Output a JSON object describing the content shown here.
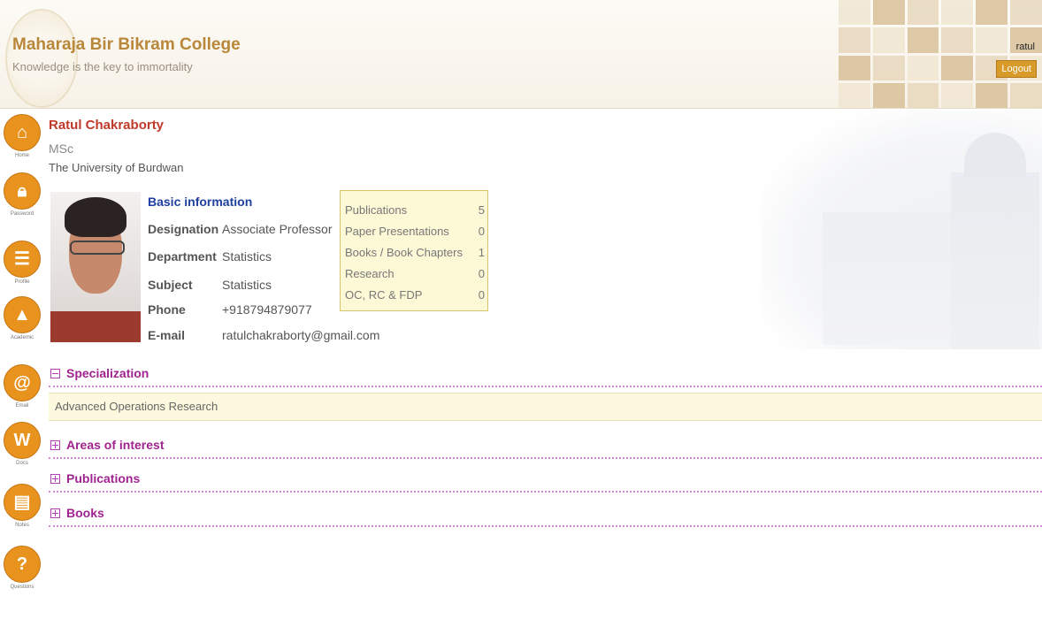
{
  "header": {
    "college_name": "Maharaja Bir Bikram College",
    "tagline": "Knowledge is the key to immortality",
    "username": "ratul",
    "logout_label": "Logout"
  },
  "sidebar": {
    "items": [
      {
        "label": "Home",
        "icon": "home-icon"
      },
      {
        "label": "Password",
        "icon": "lock-icon"
      },
      {
        "label": "Profile",
        "icon": "profile-icon"
      },
      {
        "label": "Academic",
        "icon": "graduation-cap-icon"
      },
      {
        "label": "Email",
        "icon": "at-icon"
      },
      {
        "label": "Docs",
        "icon": "word-doc-icon"
      },
      {
        "label": "Notes",
        "icon": "notes-icon"
      },
      {
        "label": "Questions",
        "icon": "question-icon"
      }
    ]
  },
  "profile": {
    "name": "Ratul Chakraborty",
    "degree": "MSc",
    "university": "The University of Burdwan"
  },
  "basic_info": {
    "title": "Basic information",
    "fields": [
      {
        "label": "Designation",
        "value": "Associate Professor"
      },
      {
        "label": "Department",
        "value": "Statistics"
      },
      {
        "label": "Subject",
        "value": "Statistics"
      },
      {
        "label": "Phone",
        "value": "+918794879077"
      },
      {
        "label": "E-mail",
        "value": "ratulchakraborty@gmail.com"
      }
    ]
  },
  "stats": [
    {
      "label": "Publications",
      "value": "5"
    },
    {
      "label": "Paper Presentations",
      "value": "0"
    },
    {
      "label": "Books / Book Chapters",
      "value": "1"
    },
    {
      "label": "Research",
      "value": "0"
    },
    {
      "label": "OC, RC & FDP",
      "value": "0"
    }
  ],
  "sections": [
    {
      "title": "Specialization",
      "expanded": true,
      "content": "Advanced Operations Research"
    },
    {
      "title": "Areas of interest",
      "expanded": false
    },
    {
      "title": "Publications",
      "expanded": false
    },
    {
      "title": "Books",
      "expanded": false
    }
  ],
  "colors": {
    "accent": "#e8931d",
    "name": "#c0392b",
    "section_title": "#a0238f",
    "basic_title": "#1f3fa0"
  }
}
